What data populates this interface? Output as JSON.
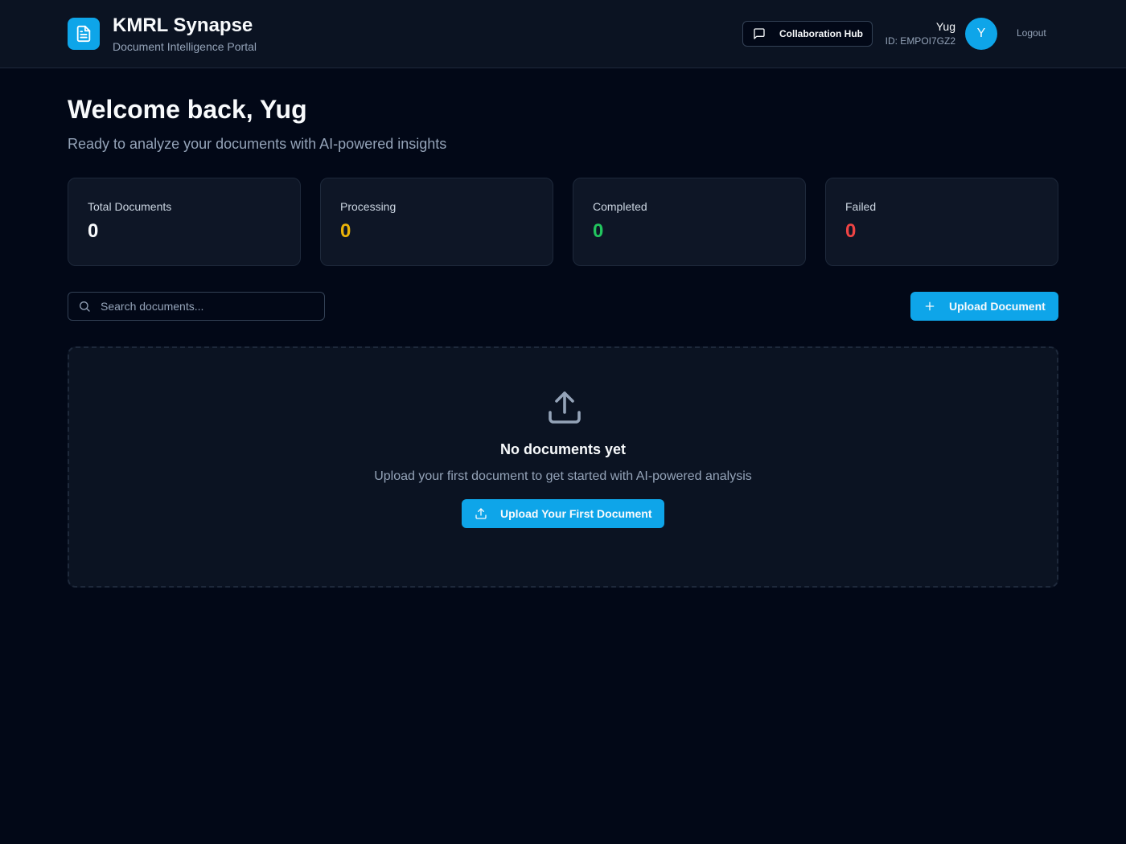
{
  "header": {
    "title": "KMRL Synapse",
    "subtitle": "Document Intelligence Portal",
    "logo_icon": "document-icon",
    "collab_label": "Collaboration Hub",
    "collab_icon": "message-square-icon",
    "user_name": "Yug",
    "user_id": "ID: EMPOI7GZ2",
    "avatar_initial": "Y",
    "logout_label": "Logout"
  },
  "welcome": {
    "heading": "Welcome back, Yug",
    "subheading": "Ready to analyze your documents with AI-powered insights"
  },
  "stats": [
    {
      "label": "Total Documents",
      "value": "0",
      "color": "#f8fafc"
    },
    {
      "label": "Processing",
      "value": "0",
      "color": "#eab308"
    },
    {
      "label": "Completed",
      "value": "0",
      "color": "#22c55e"
    },
    {
      "label": "Failed",
      "value": "0",
      "color": "#ef4444"
    }
  ],
  "toolbar": {
    "search_placeholder": "Search documents...",
    "search_icon": "search-icon",
    "upload_label": "Upload Document",
    "upload_icon": "plus-icon"
  },
  "empty_state": {
    "icon": "upload-icon",
    "title": "No documents yet",
    "text": "Upload your first document to get started with AI-powered analysis",
    "button_label": "Upload Your First Document",
    "button_icon": "upload-icon"
  },
  "colors": {
    "accent": "#0ea5e9",
    "background": "#020817",
    "card": "#0e1626",
    "border": "#1e293b"
  }
}
